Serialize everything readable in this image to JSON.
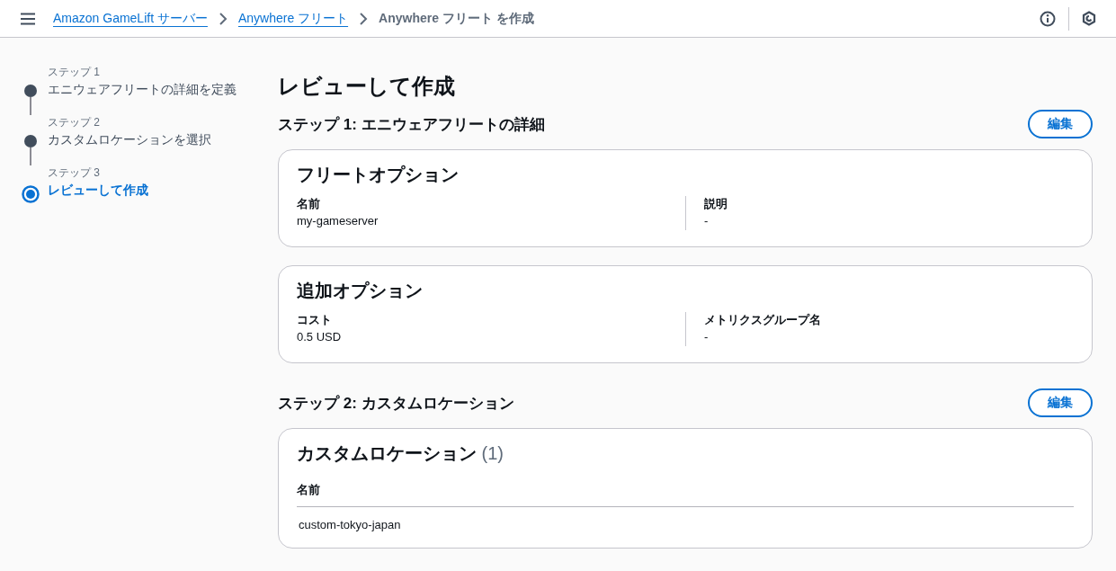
{
  "breadcrumbs": [
    {
      "label": "Amazon GameLift サーバー",
      "kind": "link"
    },
    {
      "label": "Anywhere フリート",
      "kind": "link"
    },
    {
      "label": "Anywhere フリート を作成",
      "kind": "current"
    }
  ],
  "steps": [
    {
      "number": "ステップ 1",
      "title": "エニウェアフリートの詳細を定義",
      "selected": false
    },
    {
      "number": "ステップ 2",
      "title": "カスタムロケーションを選択",
      "selected": false
    },
    {
      "number": "ステップ 3",
      "title": "レビューして作成",
      "selected": true
    }
  ],
  "page_title": "レビューして作成",
  "sections": [
    {
      "heading": "ステップ 1: エニウェアフリートの詳細",
      "edit_button": "編集",
      "cards": [
        {
          "kind": "fields",
          "title": "フリートオプション",
          "fields": [
            {
              "label": "名前",
              "value": "my-gameserver"
            },
            {
              "label": "説明",
              "value": "-"
            }
          ]
        },
        {
          "kind": "fields",
          "title": "追加オプション",
          "fields": [
            {
              "label": "コスト",
              "value": "0.5 USD"
            },
            {
              "label": "メトリクスグループ名",
              "value": "-"
            }
          ]
        }
      ]
    },
    {
      "heading": "ステップ 2: カスタムロケーション",
      "edit_button": "編集",
      "cards": [
        {
          "kind": "table",
          "title": "カスタムロケーション",
          "count": "(1)",
          "columns": [
            "名前"
          ],
          "rows": [
            [
              "custom-tokyo-japan"
            ]
          ]
        }
      ]
    }
  ]
}
